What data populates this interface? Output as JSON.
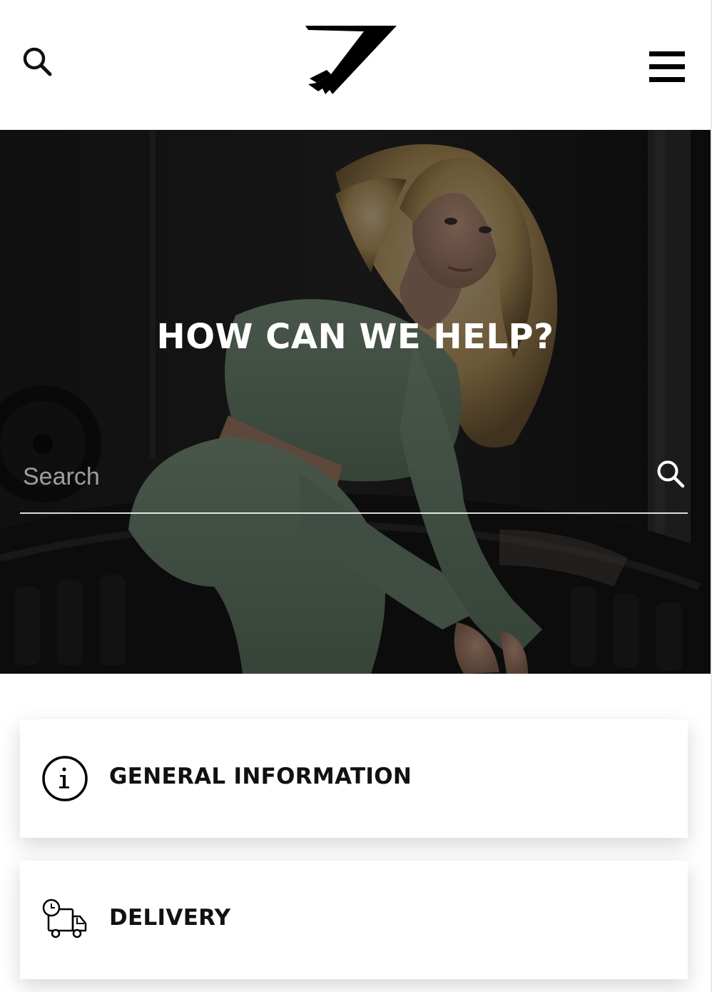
{
  "header": {
    "search_icon": "search-icon",
    "logo": "brand-logo",
    "menu_icon": "hamburger-menu-icon"
  },
  "hero": {
    "title": "HOW CAN WE HELP?",
    "search": {
      "placeholder": "Search",
      "value": "",
      "icon": "search-icon"
    }
  },
  "categories": [
    {
      "label": "GENERAL INFORMATION",
      "icon": "info-icon"
    },
    {
      "label": "DELIVERY",
      "icon": "delivery-truck-icon"
    }
  ],
  "colors": {
    "background": "#ffffff",
    "text": "#111111",
    "hero_text": "#ffffff",
    "hero_bg": "#1f1f1f"
  }
}
